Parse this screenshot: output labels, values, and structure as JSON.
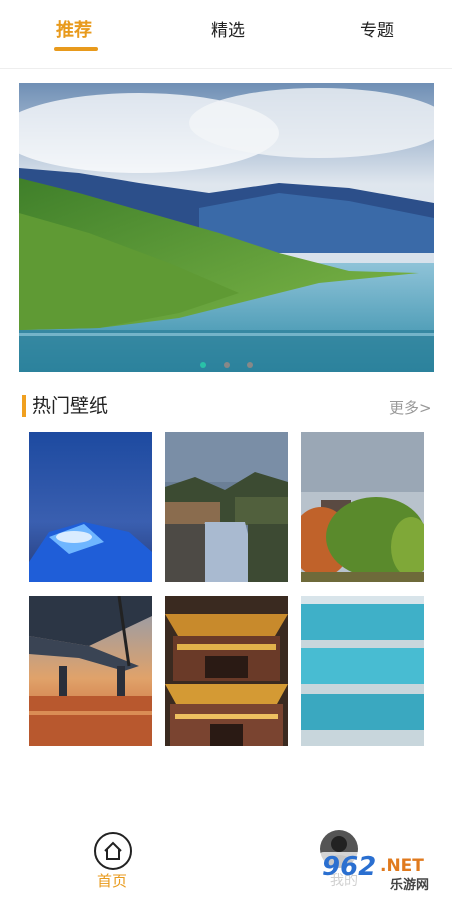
{
  "tabs": [
    {
      "label": "推荐",
      "active": true
    },
    {
      "label": "精选",
      "active": false
    },
    {
      "label": "专题",
      "active": false
    }
  ],
  "banner": {
    "dots": 3,
    "active_dot": 0
  },
  "section": {
    "title": "热门壁纸",
    "more": "更多>"
  },
  "wallpapers": [
    {
      "name": "blue-tent"
    },
    {
      "name": "canal-town"
    },
    {
      "name": "autumn-trees"
    },
    {
      "name": "bridge-sunset"
    },
    {
      "name": "palace-lights"
    },
    {
      "name": "glass-building"
    }
  ],
  "bottom_nav": {
    "home": {
      "label": "首页",
      "active": true,
      "icon": "home-icon"
    },
    "mine": {
      "label": "我的",
      "icon": "avatar-icon"
    }
  },
  "watermark": {
    "brand": "962",
    "suffix": ".NET",
    "sub": "乐游网"
  },
  "colors": {
    "accent": "#e89a1c",
    "dot_active": "#29c1a8"
  }
}
